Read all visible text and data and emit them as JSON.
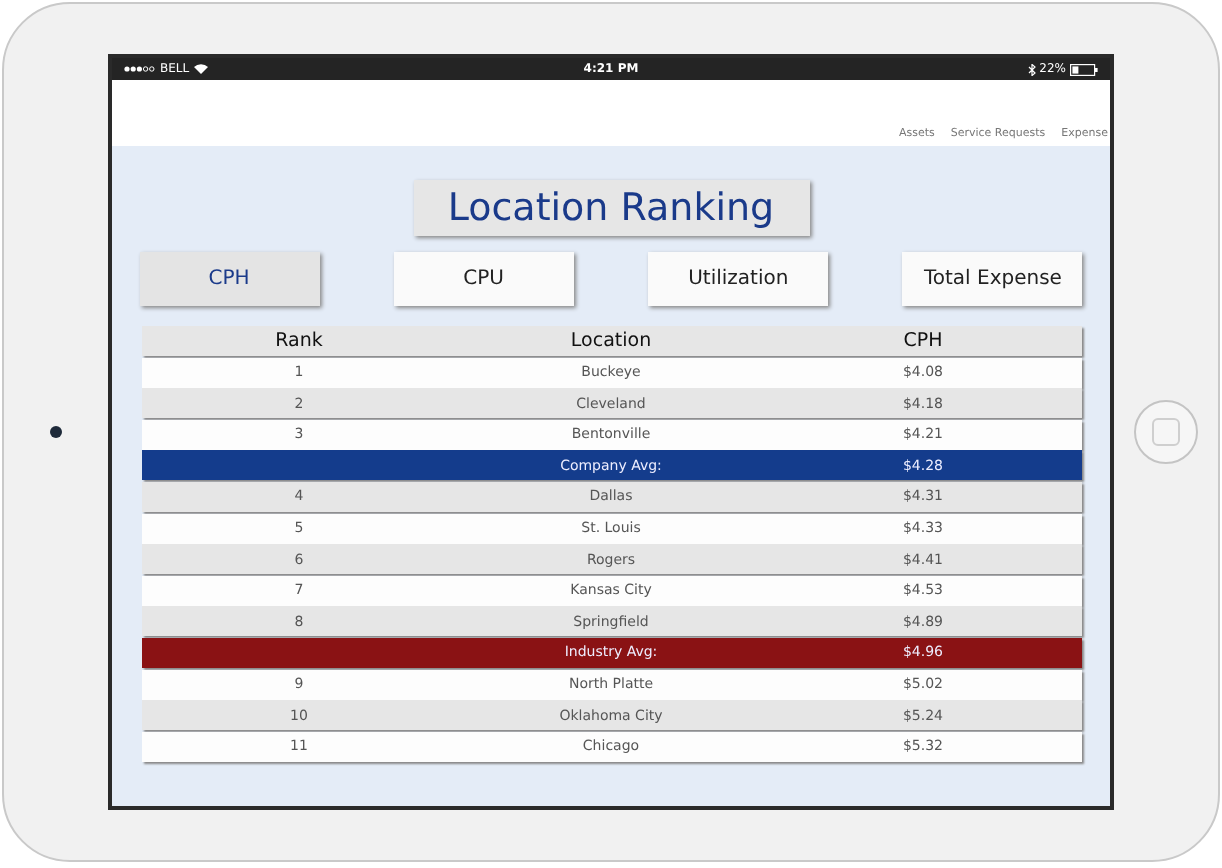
{
  "status_bar": {
    "carrier": "BELL",
    "time": "4:21 PM",
    "battery": "22%"
  },
  "nav": [
    "Assets",
    "Service Requests",
    "Expense"
  ],
  "title": "Location Ranking",
  "tabs": [
    {
      "label": "CPH",
      "selected": true
    },
    {
      "label": "CPU",
      "selected": false
    },
    {
      "label": "Utilization",
      "selected": false
    },
    {
      "label": "Total Expense",
      "selected": false
    }
  ],
  "table": {
    "columns": [
      "Rank",
      "Location",
      "CPH"
    ],
    "rows": [
      {
        "kind": "location",
        "rank": "1",
        "location": "Buckeye",
        "value": "$4.08"
      },
      {
        "kind": "location",
        "rank": "2",
        "location": "Cleveland",
        "value": "$4.18"
      },
      {
        "kind": "location",
        "rank": "3",
        "location": "Bentonville",
        "value": "$4.21"
      },
      {
        "kind": "average",
        "location": "Company Avg:",
        "value": "$4.28",
        "color": "#143c8c"
      },
      {
        "kind": "location",
        "rank": "4",
        "location": "Dallas",
        "value": "$4.31"
      },
      {
        "kind": "location",
        "rank": "5",
        "location": "St. Louis",
        "value": "$4.33"
      },
      {
        "kind": "location",
        "rank": "6",
        "location": "Rogers",
        "value": "$4.41"
      },
      {
        "kind": "location",
        "rank": "7",
        "location": "Kansas City",
        "value": "$4.53"
      },
      {
        "kind": "location",
        "rank": "8",
        "location": "Springfield",
        "value": "$4.89"
      },
      {
        "kind": "average",
        "location": "Industry Avg:",
        "value": "$4.96",
        "color": "#8a1214"
      },
      {
        "kind": "location",
        "rank": "9",
        "location": "North Platte",
        "value": "$5.02"
      },
      {
        "kind": "location",
        "rank": "10",
        "location": "Oklahoma City",
        "value": "$5.24"
      },
      {
        "kind": "location",
        "rank": "11",
        "location": "Chicago",
        "value": "$5.32"
      }
    ]
  }
}
